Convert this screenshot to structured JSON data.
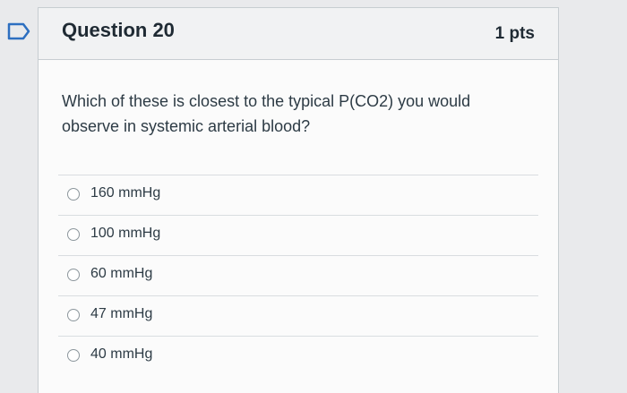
{
  "question": {
    "title": "Question 20",
    "points": "1 pts",
    "text": "Which of these is closest to the typical P(CO2) you would observe in systemic arterial blood?"
  },
  "answers": [
    {
      "label": "160 mmHg"
    },
    {
      "label": "100 mmHg"
    },
    {
      "label": "60 mmHg"
    },
    {
      "label": "47 mmHg"
    },
    {
      "label": "40 mmHg"
    }
  ],
  "icons": {
    "bookmark": "bookmark-flag-icon"
  },
  "colors": {
    "accent": "#2d6fc0",
    "text": "#2d3b45",
    "header_bg": "#f1f2f3",
    "border": "#c7cdd1"
  }
}
